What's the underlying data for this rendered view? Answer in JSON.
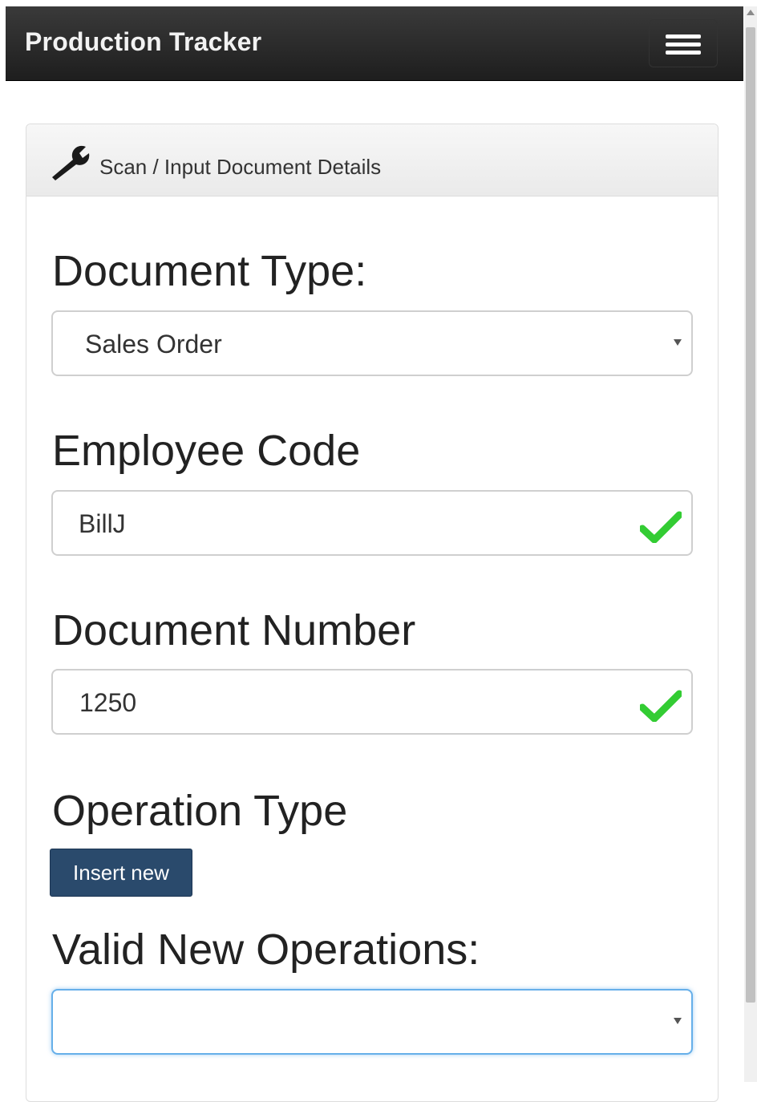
{
  "navbar": {
    "brand": "Production Tracker",
    "menu_icon": "hamburger-menu-icon"
  },
  "panel": {
    "icon": "wrench-icon",
    "title": "Scan / Input Document Details"
  },
  "form": {
    "document_type": {
      "label": "Document Type:",
      "value": "Sales Order"
    },
    "employee_code": {
      "label": "Employee Code",
      "value": "BillJ",
      "status_icon": "checkmark-icon",
      "status_color": "#33cc33"
    },
    "document_number": {
      "label": "Document Number",
      "value": "1250",
      "status_icon": "checkmark-icon",
      "status_color": "#33cc33"
    },
    "operation_type": {
      "label": "Operation Type",
      "button_label": "Insert new"
    },
    "valid_new_operations": {
      "label": "Valid New Operations:",
      "value": ""
    }
  },
  "colors": {
    "navbar_bg": "#222222",
    "primary_button": "#2a4a6c",
    "focus_border": "#66afe9"
  }
}
